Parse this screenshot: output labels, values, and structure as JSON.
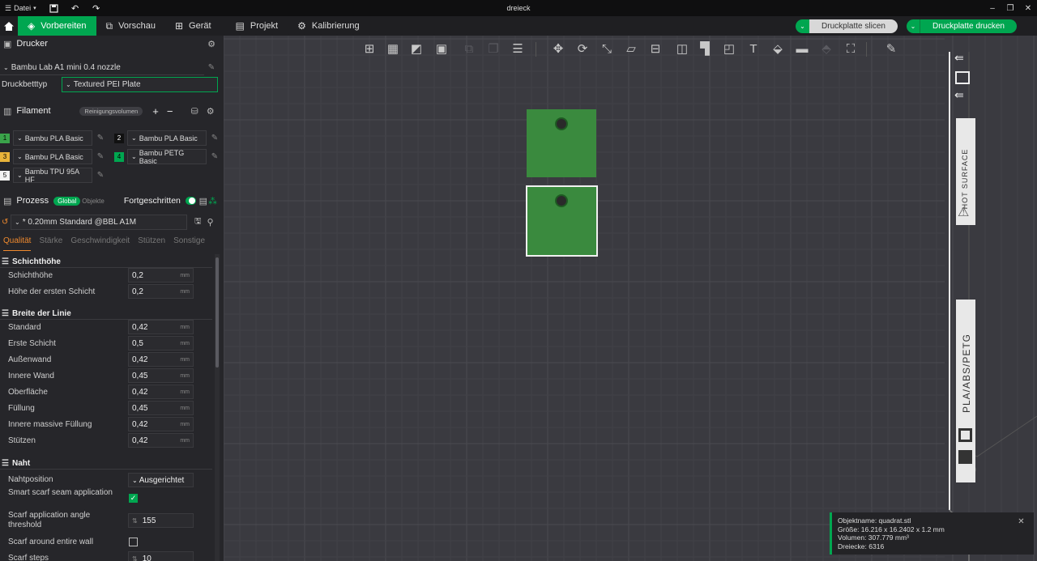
{
  "titlebar": {
    "menu_label": "Datei",
    "window_title": "dreieck"
  },
  "tabs": [
    {
      "label": "Vorbereiten",
      "active": true
    },
    {
      "label": "Vorschau"
    },
    {
      "label": "Gerät"
    },
    {
      "label": "Projekt"
    },
    {
      "label": "Kalibrierung"
    }
  ],
  "actions": {
    "slice_label": "Druckplatte slicen",
    "print_label": "Druckplatte drucken"
  },
  "printer": {
    "section_label": "Drucker",
    "name": "Bambu Lab A1 mini 0.4 nozzle",
    "bed_label": "Druckbetttyp",
    "bed_value": "Textured PEI Plate"
  },
  "filament": {
    "section_label": "Filament",
    "purge_label": "Reinigungsvolumen",
    "slots": [
      {
        "num": "1",
        "name": "Bambu PLA Basic",
        "color": "#3aa34a"
      },
      {
        "num": "2",
        "name": "Bambu PLA Basic",
        "color": "#111111"
      },
      {
        "num": "3",
        "name": "Bambu PLA Basic",
        "color": "#e8b33a"
      },
      {
        "num": "4",
        "name": "Bambu PETG Basic",
        "color": "#00a650"
      },
      {
        "num": "5",
        "name": "Bambu TPU 95A HF",
        "color": "#f2f2f2"
      }
    ]
  },
  "process": {
    "section_label": "Prozess",
    "global_label": "Global",
    "objects_label": "Objekte",
    "advanced_label": "Fortgeschritten",
    "preset": "* 0.20mm Standard @BBL A1M",
    "subtabs": [
      "Qualität",
      "Stärke",
      "Geschwindigkeit",
      "Stützen",
      "Sonstige"
    ]
  },
  "settings": {
    "groups": [
      {
        "title": "Schichthöhe"
      },
      {
        "title": "Breite der Linie"
      },
      {
        "title": "Naht"
      }
    ],
    "params": [
      {
        "label": "Schichthöhe",
        "value": "0,2",
        "unit": "mm"
      },
      {
        "label": "Höhe der ersten Schicht",
        "value": "0,2",
        "unit": "mm"
      },
      {
        "label": "Standard",
        "value": "0,42",
        "unit": "mm"
      },
      {
        "label": "Erste Schicht",
        "value": "0,5",
        "unit": "mm"
      },
      {
        "label": "Außenwand",
        "value": "0,42",
        "unit": "mm"
      },
      {
        "label": "Innere Wand",
        "value": "0,45",
        "unit": "mm"
      },
      {
        "label": "Oberfläche",
        "value": "0,42",
        "unit": "mm"
      },
      {
        "label": "Füllung",
        "value": "0,45",
        "unit": "mm"
      },
      {
        "label": "Innere massive Füllung",
        "value": "0,42",
        "unit": "mm"
      },
      {
        "label": "Stützen",
        "value": "0,42",
        "unit": "mm"
      }
    ],
    "seam": {
      "position_label": "Nahtposition",
      "position_value": "Ausgerichtet",
      "scarf_label": "Smart scarf seam application",
      "angle_label": "Scarf application angle threshold",
      "angle_value": "155",
      "around_label": "Scarf around entire wall",
      "steps_label": "Scarf steps",
      "steps_value": "10"
    }
  },
  "plate": {
    "side_label": "PLA/ABS/PETG",
    "hot_label": "HOT SURFACE"
  },
  "object_info": {
    "name": "Objektname: quadrat.stl",
    "size": "Größe: 16.216 x 16.2402 x 1.2 mm",
    "volume": "Volumen: 307.779 mm³",
    "triangles": "Dreiecke: 6316"
  },
  "colors": {
    "accent": "#00a650",
    "object": "#3a8a3e",
    "bg": "#3a3a40"
  }
}
